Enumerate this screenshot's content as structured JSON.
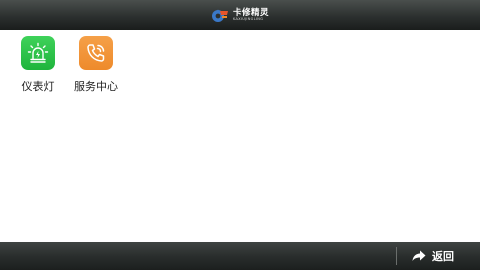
{
  "header": {
    "brand_name": "卡修精灵",
    "brand_subtitle": "KAXIUJINGLING",
    "logo_icon": "car-gear-logo-icon"
  },
  "apps": [
    {
      "label": "仪表灯",
      "icon": "dashboard-warning-light-icon",
      "color": "#2dc44a"
    },
    {
      "label": "服务中心",
      "icon": "phone-call-icon",
      "color": "#f09535"
    }
  ],
  "footer": {
    "back_label": "返回",
    "back_icon": "share-arrow-icon"
  }
}
